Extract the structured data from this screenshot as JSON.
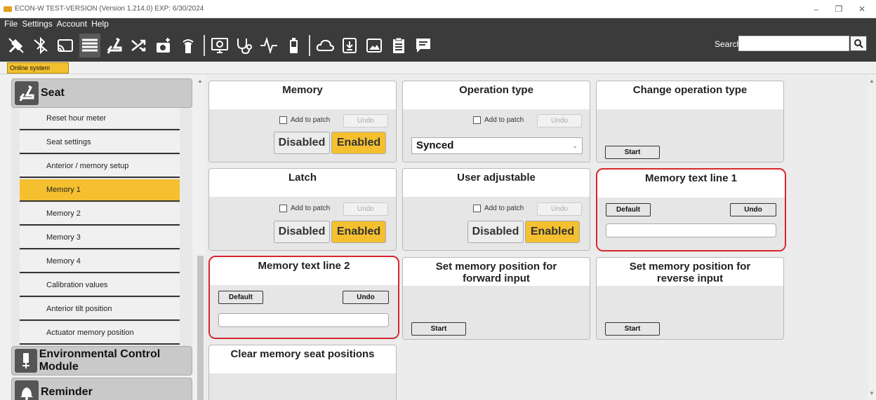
{
  "window": {
    "title": "ECON-W TEST-VERSION (Version 1.214.0) EXP: 6/30/2024",
    "controls": [
      "–",
      "❐",
      "✕"
    ]
  },
  "menu": [
    "File",
    "Settings",
    "Account",
    "Help"
  ],
  "toolbar": {
    "icons": [
      "disconnect-icon",
      "bluetooth-off-icon",
      "cast-icon",
      "list-icon",
      "seat-icon",
      "shuffle-icon",
      "camera-plus-icon",
      "remote-icon",
      "monitor-icon",
      "stethoscope-icon",
      "pulse-icon",
      "battery-icon",
      "cloud-icon",
      "download-icon",
      "image-icon",
      "clipboard-icon",
      "comment-icon"
    ],
    "search_label": "Search"
  },
  "tab": "Online system",
  "sidebar": {
    "sections": [
      {
        "label": "Seat",
        "icon": "seat-icon"
      },
      {
        "label": "Environmental Control Module",
        "icon": "ecm-icon"
      },
      {
        "label": "Reminder",
        "icon": "bell-icon"
      }
    ],
    "items": [
      {
        "label": "Reset hour meter",
        "active": false
      },
      {
        "label": "Seat settings",
        "active": false
      },
      {
        "label": "Anterior / memory setup",
        "active": false
      },
      {
        "label": "Memory 1",
        "active": true
      },
      {
        "label": "Memory 2",
        "active": false
      },
      {
        "label": "Memory 3",
        "active": false
      },
      {
        "label": "Memory 4",
        "active": false
      },
      {
        "label": "Calibration values",
        "active": false
      },
      {
        "label": "Anterior tilt position",
        "active": false
      },
      {
        "label": "Actuator memory position",
        "active": false
      }
    ]
  },
  "cards": {
    "memory": {
      "title": "Memory",
      "add_to_patch": "Add to patch",
      "undo": "Undo",
      "disabled": "Disabled",
      "enabled": "Enabled",
      "value": "Enabled"
    },
    "operation_type": {
      "title": "Operation type",
      "add_to_patch": "Add to patch",
      "undo": "Undo",
      "value": "Synced"
    },
    "change_operation_type": {
      "title": "Change operation type",
      "start": "Start"
    },
    "latch": {
      "title": "Latch",
      "add_to_patch": "Add to patch",
      "undo": "Undo",
      "disabled": "Disabled",
      "enabled": "Enabled",
      "value": "Enabled"
    },
    "user_adjustable": {
      "title": "User adjustable",
      "add_to_patch": "Add to patch",
      "undo": "Undo",
      "disabled": "Disabled",
      "enabled": "Enabled",
      "value": "Enabled"
    },
    "memory_text_line_1": {
      "title": "Memory text line 1",
      "default": "Default",
      "undo": "Undo",
      "value": ""
    },
    "memory_text_line_2": {
      "title": "Memory text line 2",
      "default": "Default",
      "undo": "Undo",
      "value": ""
    },
    "set_memory_forward": {
      "title": "Set memory position for forward input",
      "start": "Start"
    },
    "set_memory_reverse": {
      "title": "Set memory position for reverse input",
      "start": "Start"
    },
    "clear_memory": {
      "title": "Clear memory seat positions"
    }
  },
  "colors": {
    "accent": "#f4c02f",
    "highlight": "#d8262c",
    "dark": "#3b3b3b"
  }
}
